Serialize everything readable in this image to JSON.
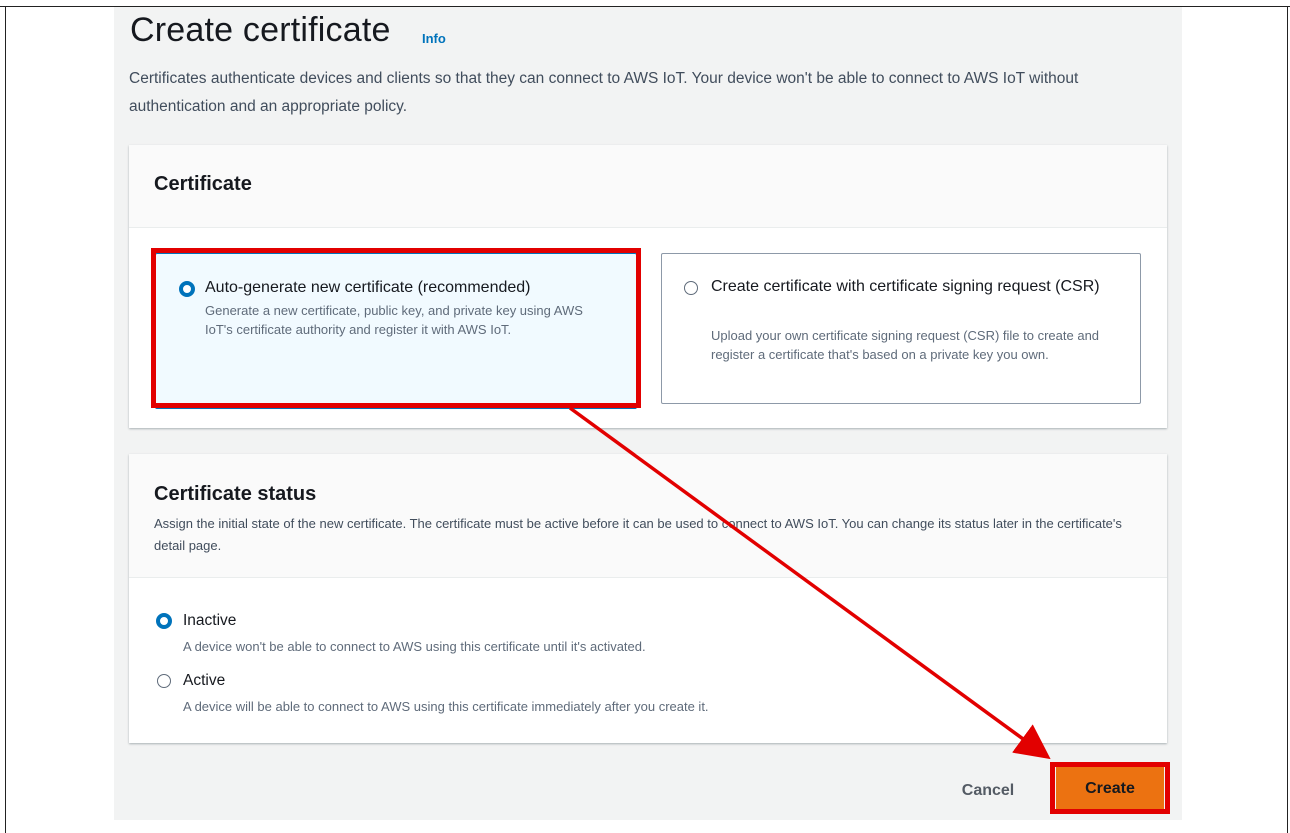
{
  "header": {
    "title": "Create certificate",
    "info_link": "Info",
    "description": "Certificates authenticate devices and clients so that they can connect to AWS IoT. Your device won't be able to connect to AWS IoT without authentication and an appropriate policy."
  },
  "certificate_section": {
    "title": "Certificate",
    "options": [
      {
        "label": "Auto-generate new certificate (recommended)",
        "description": "Generate a new certificate, public key, and private key using AWS IoT's certificate authority and register it with AWS IoT.",
        "selected": true
      },
      {
        "label": "Create certificate with certificate signing request (CSR)",
        "description": "Upload your own certificate signing request (CSR) file to create and register a certificate that's based on a private key you own.",
        "selected": false
      }
    ]
  },
  "status_section": {
    "title": "Certificate status",
    "description": "Assign the initial state of the new certificate. The certificate must be active before it can be used to connect to AWS IoT. You can change its status later in the certificate's detail page.",
    "options": [
      {
        "label": "Inactive",
        "description": "A device won't be able to connect to AWS using this certificate until it's activated.",
        "selected": true
      },
      {
        "label": "Active",
        "description": "A device will be able to connect to AWS using this certificate immediately after you create it.",
        "selected": false
      }
    ]
  },
  "footer": {
    "cancel_label": "Cancel",
    "create_label": "Create"
  },
  "colors": {
    "accent_blue": "#0073bb",
    "primary_orange": "#ec7211",
    "highlight_red": "#e20000",
    "page_background": "#f2f3f3"
  }
}
